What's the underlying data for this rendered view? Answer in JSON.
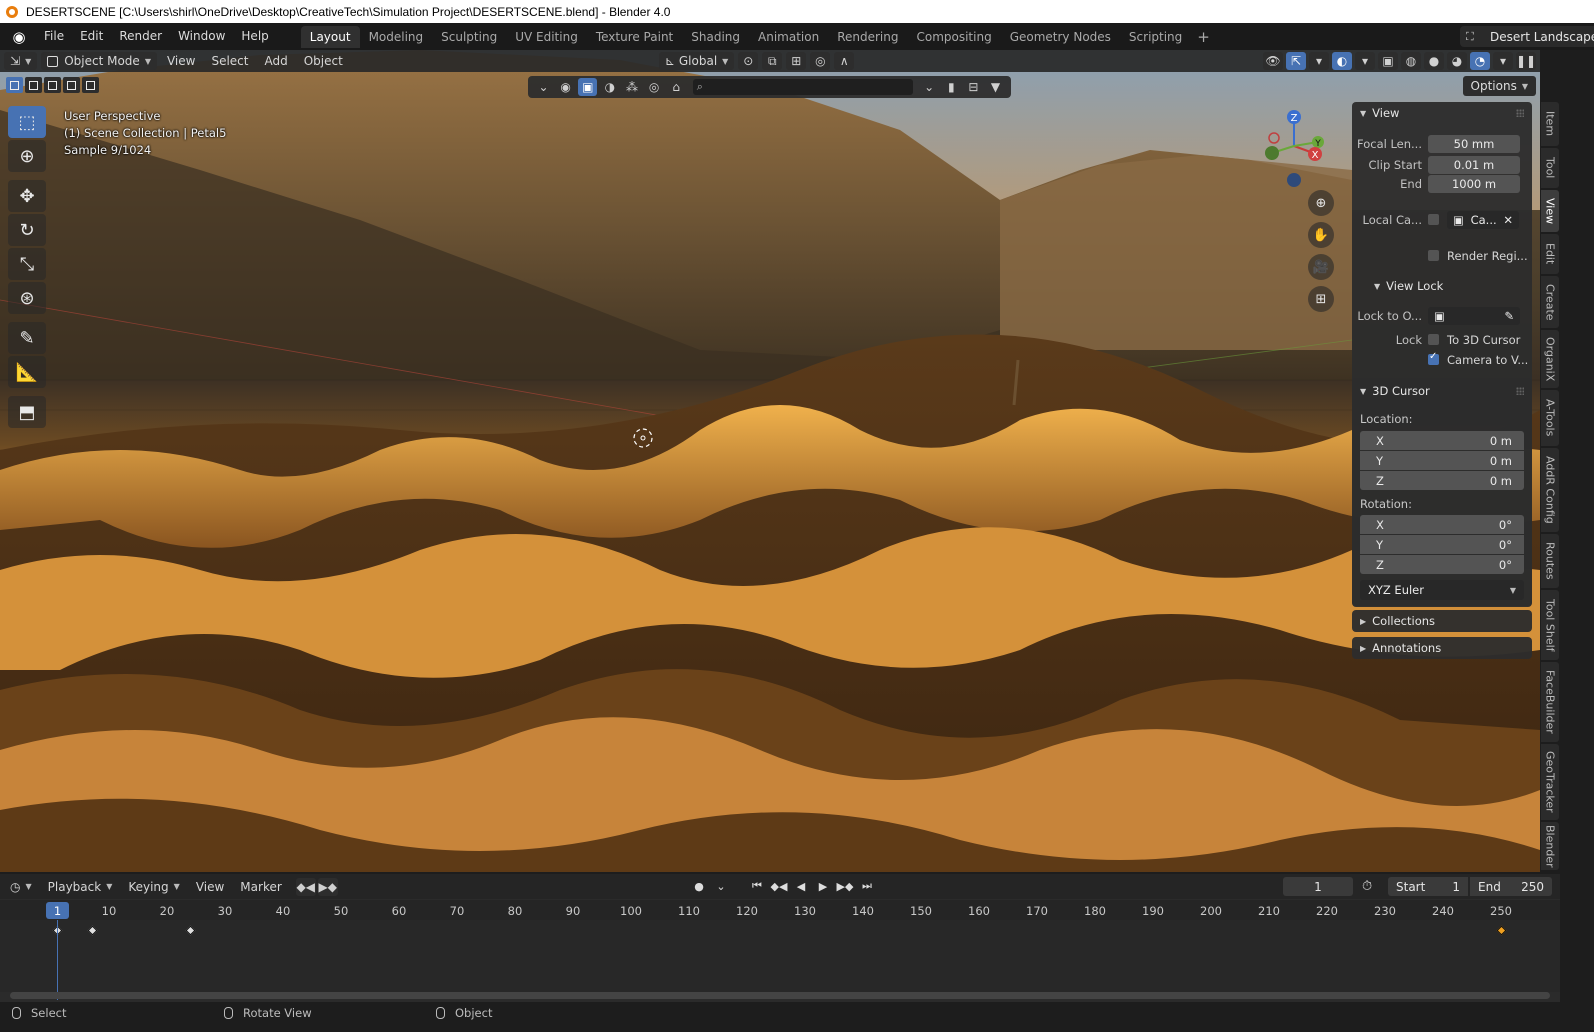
{
  "window": {
    "title": "DESERTSCENE [C:\\Users\\shirl\\OneDrive\\Desktop\\CreativeTech\\Simulation Project\\DESERTSCENE.blend] - Blender 4.0"
  },
  "menubar": {
    "menus": [
      "File",
      "Edit",
      "Render",
      "Window",
      "Help"
    ],
    "workspaces": [
      "Layout",
      "Modeling",
      "Sculpting",
      "UV Editing",
      "Texture Paint",
      "Shading",
      "Animation",
      "Rendering",
      "Compositing",
      "Geometry Nodes",
      "Scripting"
    ],
    "active_workspace": "Layout",
    "add_workspace": "+",
    "scene_name": "Desert Landscape"
  },
  "viewport_header": {
    "mode": "Object Mode",
    "menus": [
      "View",
      "Select",
      "Add",
      "Object"
    ],
    "transform_orientation": "Global",
    "options": "Options"
  },
  "viewport_info": {
    "perspective": "User Perspective",
    "collection": "(1) Scene Collection | Petal5",
    "sample": "Sample 9/1024"
  },
  "gizmo": {
    "x": "X",
    "y": "Y",
    "z": "Z"
  },
  "npanel": {
    "view": {
      "title": "View",
      "focal_length_label": "Focal Len...",
      "focal_length": "50 mm",
      "clip_start_label": "Clip Start",
      "clip_start": "0.01 m",
      "clip_end_label": "End",
      "clip_end": "1000 m",
      "local_camera_label": "Local Ca...",
      "local_camera_value": "Ca...",
      "render_region_label": "Render Regi..."
    },
    "view_lock": {
      "title": "View Lock",
      "lock_to_object_label": "Lock to O...",
      "lock_label": "Lock",
      "to_3d_cursor": "To 3D Cursor",
      "to_3d_cursor_checked": false,
      "camera_to_view": "Camera to V...",
      "camera_to_view_checked": true
    },
    "cursor": {
      "title": "3D Cursor",
      "location_label": "Location:",
      "loc_x_label": "X",
      "loc_x": "0 m",
      "loc_y_label": "Y",
      "loc_y": "0 m",
      "loc_z_label": "Z",
      "loc_z": "0 m",
      "rotation_label": "Rotation:",
      "rot_x_label": "X",
      "rot_x": "0°",
      "rot_y_label": "Y",
      "rot_y": "0°",
      "rot_z_label": "Z",
      "rot_z": "0°",
      "rotation_mode": "XYZ Euler"
    },
    "collections": "Collections",
    "annotations": "Annotations"
  },
  "sidebar_tabs": [
    "Item",
    "Tool",
    "View",
    "Edit",
    "Create",
    "OrganiX",
    "A-Tools",
    "AddR Config",
    "Routes",
    "Tool Shelf",
    "FaceBuilder",
    "GeoTracker",
    "Blender"
  ],
  "active_sidebar_tab": "View",
  "timeline": {
    "menus": [
      "Playback",
      "Keying",
      "View",
      "Marker"
    ],
    "current_frame": "1",
    "start_label": "Start",
    "start": "1",
    "end_label": "End",
    "end": "250",
    "ticks": [
      "10",
      "20",
      "30",
      "40",
      "50",
      "60",
      "70",
      "80",
      "90",
      "100",
      "110",
      "120",
      "130",
      "140",
      "150",
      "160",
      "170",
      "180",
      "190",
      "200",
      "210",
      "220",
      "230",
      "240",
      "250"
    ],
    "playhead_frame": "1"
  },
  "statusbar": {
    "items": [
      "Select",
      "Rotate View",
      "Object"
    ]
  },
  "colors": {
    "accent": "#4772b3",
    "keyframe_selected": "#f0a020",
    "sand": "#c8832f"
  }
}
